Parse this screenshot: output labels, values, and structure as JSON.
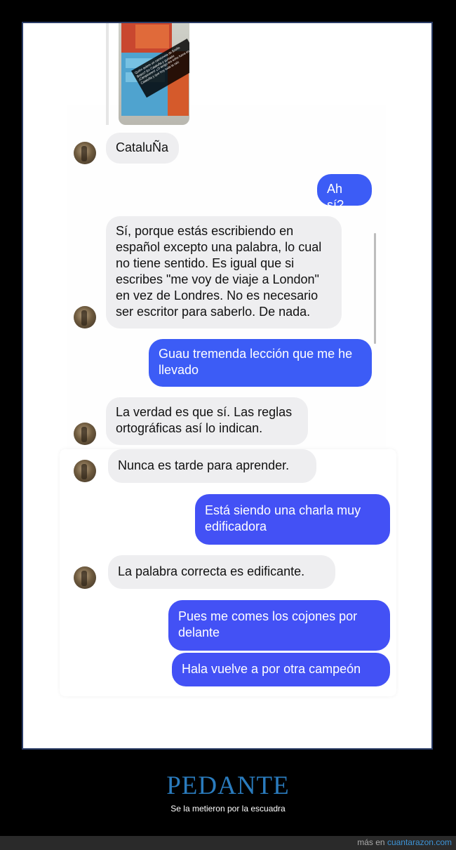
{
  "story": {
    "caption": "Quién quiere un camioneta de Ereño Bravo? En Cataluña y guisado ¡Cámpeones! ¿O tengo les echo fuera en Cataluña y que hoy toda la raíz"
  },
  "messages": [
    {
      "from": "them",
      "text": "CataluÑa"
    },
    {
      "from": "me",
      "text": "Ah sí?"
    },
    {
      "from": "them",
      "text": "Sí, porque estás escribiendo en\nespañol excepto una palabra, lo cual\nno tiene sentido. Es igual que si\nescribes \"me voy de viaje a London\"\nen vez de Londres. No es necesario\nser escritor para saberlo. De nada."
    },
    {
      "from": "me",
      "text": "Guau tremenda lección que me he\nllevado"
    },
    {
      "from": "them",
      "text": "La verdad es que sí. Las reglas\nortográficas así lo indican."
    },
    {
      "from": "them",
      "text": "Nunca es tarde para aprender."
    },
    {
      "from": "me",
      "text": "Está siendo una charla muy\nedificadora"
    },
    {
      "from": "them",
      "text": "La palabra correcta es edificante."
    },
    {
      "from": "me",
      "text": "Pues me comes los cojones por\ndelante"
    },
    {
      "from": "me",
      "text": "Hala vuelve a por otra campeón"
    }
  ],
  "post": {
    "title": "PEDANTE",
    "subtitle": "Se la metieron por la escuadra"
  },
  "footer": {
    "prefix": "más en",
    "site": "cuantarazon.com"
  },
  "colors": {
    "outgoing_bubble": "#3c5cf6",
    "incoming_bubble": "#eeeef0",
    "title": "#2a7bbd",
    "link": "#3d93d6"
  }
}
